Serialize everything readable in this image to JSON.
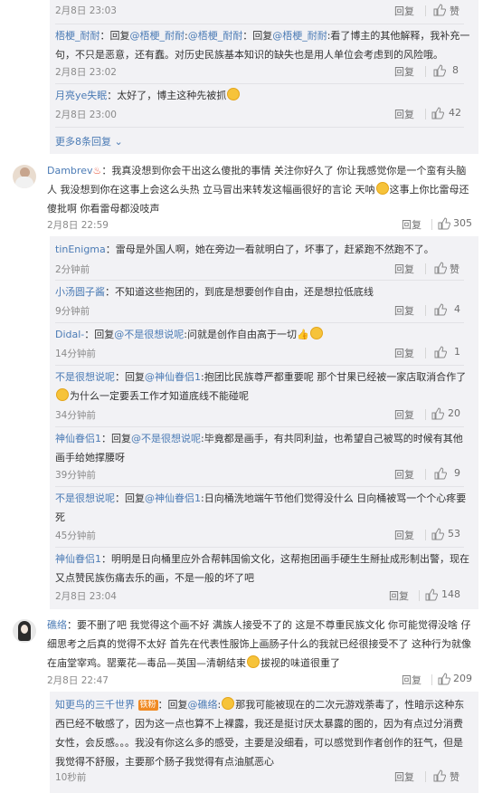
{
  "labels": {
    "reply": "回复",
    "like": "赞",
    "more_replies": "更多8条回复"
  },
  "colors": {
    "user": "#eb7350",
    "link": "#4b7bb5",
    "reply_bg": "#f2f2f5"
  },
  "top_item": {
    "time": "2月8日 23:03"
  },
  "sub1": [
    {
      "user": "梧梗_耐耐",
      "pre": "：回复",
      "m1": "@梧梗_耐耐",
      "mid": ":",
      "m2": "@梧梗_耐耐",
      "sep2": "：回复",
      "m3": "@梧梗_耐耐",
      "text": ":看了博主的其他解释，我补充一句，不只是恶意，还有蠢。对历史民族基本知识的缺失也是用人单位会考虑到的风险哦。",
      "time": "2月8日 23:02",
      "likes": "8"
    },
    {
      "user": "月亮ye失眠",
      "text": "：太好了，博主这种先被抓",
      "time": "2月8日 23:00",
      "likes": "42"
    }
  ],
  "c1": {
    "user": "Dambrev",
    "text1": "：我真没想到你会干出这么傻批的事情 关注你好久了 你让我感觉你是一个蛮有头脑人 我没想到你在这事上会这么头热 立马冒出来转发这幅画很好的言论 天呐",
    "text2": "这事上你比雷母还傻批啊 你看雷母都没吱声",
    "time": "2月8日 22:59",
    "likes": "305"
  },
  "c1_replies": [
    {
      "user": "tinEnigma",
      "text": "：雷母是外国人啊，她在旁边一看就明白了，坏事了，赶紧跑不然跑不了。",
      "time": "2分钟前",
      "likes": ""
    },
    {
      "user": "小汤圆子酱",
      "text": "：不知道这些抱团的，到底是想要创作自由，还是想拉低底线",
      "time": "9分钟前",
      "likes": "4"
    },
    {
      "user": "Didal-",
      "pre": "：回复",
      "mention": "@不是很想说呢",
      "text": ":问就是创作自由高于一切",
      "time": "14分钟前",
      "likes": "1"
    },
    {
      "user": "不是很想说呢",
      "pre": "：回复",
      "mention": "@神仙眷侣1",
      "text": ":抱团比民族尊严都重要呢 那个甘果已经被一家店取消合作了",
      "text2": "为什么一定要丢工作才知道底线不能碰呢",
      "time": "34分钟前",
      "likes": "20"
    },
    {
      "user": "神仙眷侣1",
      "pre": "：回复",
      "mention": "@不是很想说呢",
      "text": ":毕竟都是画手，有共同利益，也希望自己被骂的时候有其他画手给她撑腰呀",
      "time": "39分钟前",
      "likes": "9"
    },
    {
      "user": "不是很想说呢",
      "pre": "：回复",
      "mention": "@神仙眷侣1",
      "text": ":日向桶洗地端午节他们觉得没什么 日向桶被骂一个个心疼要死",
      "time": "45分钟前",
      "likes": "53"
    },
    {
      "user": "神仙眷侣1",
      "text": "：明明是日向桶里应外合帮韩国偷文化，这帮抱团画手硬生生掰扯成形制出警，现在又点赞民族伤痛去乐的画，不是一般的坏了吧",
      "time": "2月8日 23:04",
      "likes": "148"
    }
  ],
  "c2": {
    "user": "礁络",
    "text1": "：要不删了吧 我觉得这个画不好 满族人接受不了的 这是不尊重民族文化 你可能觉得没啥 仔细思考之后真的觉得不太好 首先在代表性服饰上画肠子什么的我就已经很接受不了 这种行为就像在庙堂宰鸡。罂粟花—毒品—英国—清朝结束",
    "text2": "拔视的味道很重了",
    "time": "2月8日 22:47",
    "likes": "209"
  },
  "c2_reply": {
    "user": "知更鸟的三千世界",
    "tag": "铁粉",
    "pre": "：回复",
    "mention": "@礁络",
    "text": ":",
    "text2": "那我可能被现在的二次元游戏荼毒了，性暗示这种东西已经不敏感了，因为这一点也算不上裸露，我还是挺讨厌太暴露的图的，因为有点过分消费女性，会反感。。。我没有你这么多的感受，主要是没细看，可以感觉到作者创作的狂气，但是我觉得不舒服，主要那个肠子我觉得有点油腻恶心",
    "time": "10秒前"
  }
}
